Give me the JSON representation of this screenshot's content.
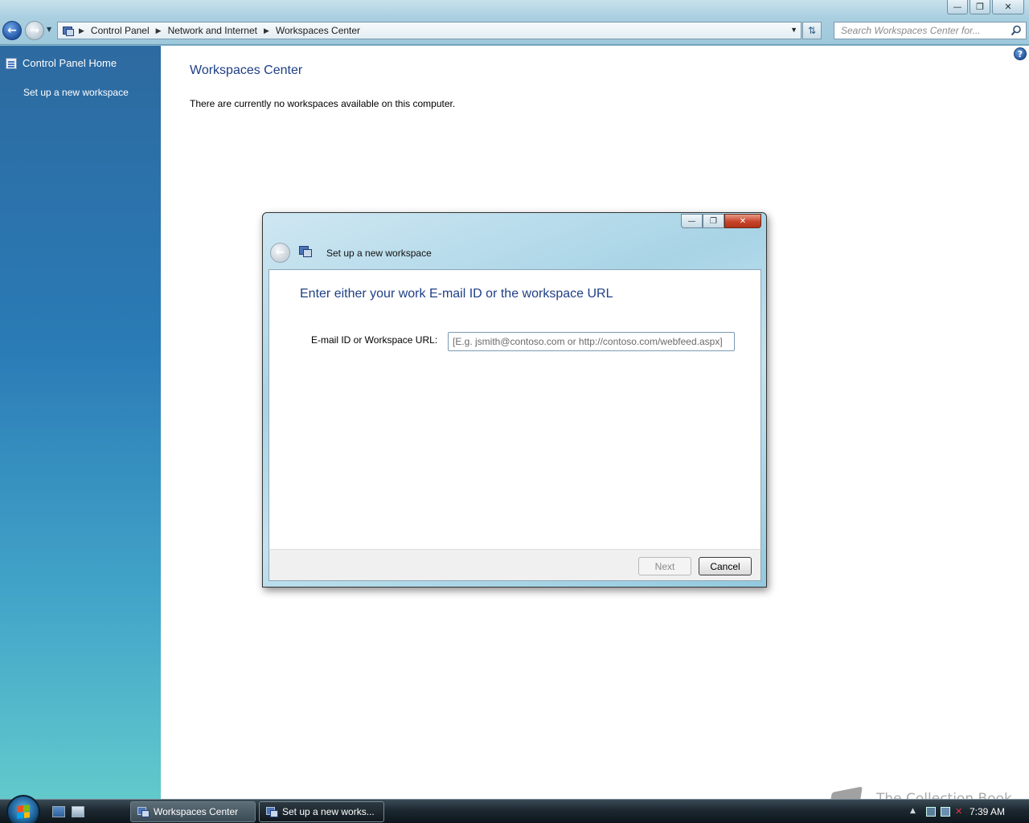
{
  "window": {
    "controls": {
      "minimize": "—",
      "maximize": "❐",
      "close": "✕"
    }
  },
  "toolbar": {
    "back_icon": "back-arrow-icon",
    "forward_icon": "forward-arrow-icon",
    "breadcrumbs": [
      "Control Panel",
      "Network and Internet",
      "Workspaces Center"
    ],
    "search_placeholder": "Search Workspaces Center for..."
  },
  "sidebar": {
    "home_label": "Control Panel Home",
    "tasks": [
      {
        "label": "Set up a new workspace"
      }
    ]
  },
  "main": {
    "title": "Workspaces Center",
    "message": "There are currently no workspaces available on this computer.",
    "help_glyph": "?"
  },
  "dialog": {
    "title": "Set up a new workspace",
    "heading": "Enter either your work E-mail ID or the workspace URL",
    "field_label": "E-mail ID or Workspace URL:",
    "field_placeholder": "[E.g. jsmith@contoso.com or http://contoso.com/webfeed.aspx]",
    "field_value": "",
    "next_label": "Next",
    "next_enabled": false,
    "cancel_label": "Cancel"
  },
  "taskbar": {
    "buttons": [
      {
        "label": "Workspaces Center",
        "active": false
      },
      {
        "label": "Set up a new works...",
        "active": true
      }
    ],
    "clock": "7:39 AM"
  },
  "watermark": {
    "text": "The Collection Book"
  },
  "colors": {
    "accent_title": "#1e3f86",
    "sidebar_top": "#2d6aa0",
    "sidebar_bottom": "#62c9cc",
    "close_red": "#c7442a"
  }
}
